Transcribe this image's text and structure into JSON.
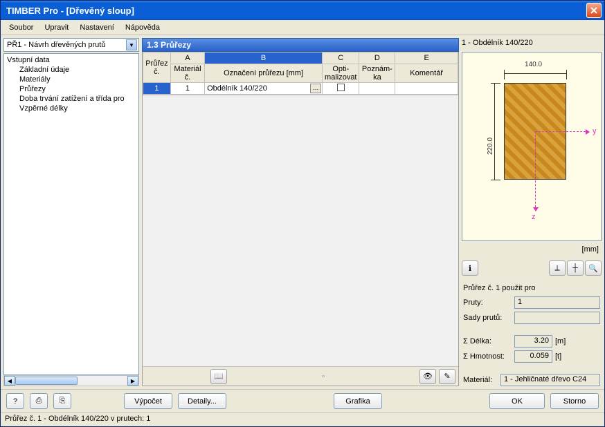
{
  "title": "TIMBER Pro - [Dřevěný sloup]",
  "menu": {
    "file": "Soubor",
    "edit": "Upravit",
    "settings": "Nastavení",
    "help": "Nápověda"
  },
  "combo": {
    "selected": "PŘ1 - Návrh dřevěných prutů"
  },
  "tree": {
    "root": "Vstupní data",
    "items": [
      "Základní údaje",
      "Materiály",
      "Průřezy",
      "Doba trvání zatížení a třída pro",
      "Vzpěrné délky"
    ],
    "selected_index": 2
  },
  "section": {
    "title": "1.3 Průřezy"
  },
  "grid": {
    "col_letters": [
      "A",
      "B",
      "C",
      "D",
      "E"
    ],
    "headers": {
      "rownum": "Průřez č.",
      "A": "Materiál č.",
      "B": "Označení průřezu [mm]",
      "C": "Opti- malizovat",
      "D": "Poznám- ka",
      "E": "Komentář"
    },
    "rows": [
      {
        "num": "1",
        "material": "1",
        "label": "Obdélník 140/220",
        "optimize": false,
        "note": "",
        "comment": ""
      }
    ]
  },
  "preview": {
    "title": "1 - Obdélník 140/220",
    "width_label": "140.0",
    "height_label": "220.0",
    "axis_y": "y",
    "axis_z": "z",
    "unit": "[mm]"
  },
  "info": {
    "used_for": "Průřez č. 1 použit pro",
    "pruty_label": "Pruty:",
    "pruty_value": "1",
    "sady_label": "Sady prutů:",
    "sady_value": "",
    "length_label": "Σ Délka:",
    "length_value": "3.20",
    "length_unit": "[m]",
    "mass_label": "Σ Hmotnost:",
    "mass_value": "0.059",
    "mass_unit": "[t]",
    "material_label": "Materiál:",
    "material_value": "1 - Jehličnaté dřevo C24"
  },
  "buttons": {
    "calc": "Výpočet",
    "details": "Detaily...",
    "graphics": "Grafika",
    "ok": "OK",
    "cancel": "Storno"
  },
  "status": "Průřez č. 1 - Obdélník 140/220 v prutech: 1"
}
